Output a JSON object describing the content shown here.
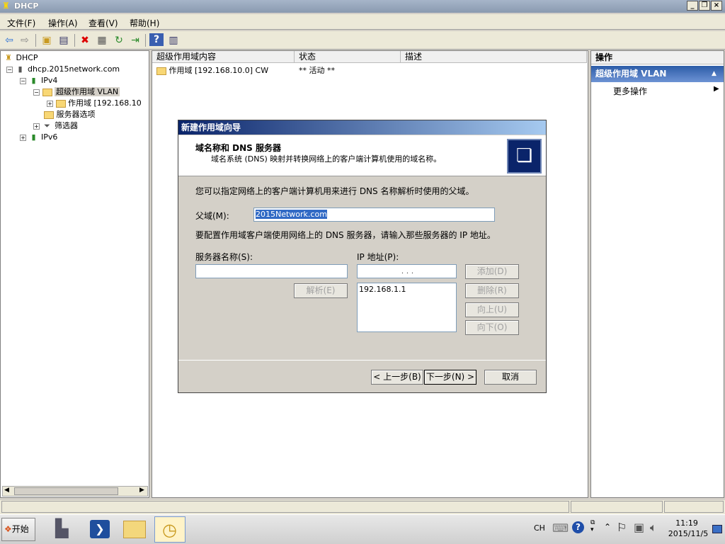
{
  "window": {
    "title": "DHCP"
  },
  "menu": [
    "文件(F)",
    "操作(A)",
    "查看(V)",
    "帮助(H)"
  ],
  "tree": {
    "root": "DHCP",
    "server": "dhcp.2015network.com",
    "ipv4": "IPv4",
    "superscope": "超级作用域 VLAN",
    "scope": "作用域 [192.168.10",
    "server_options": "服务器选项",
    "filters": "筛选器",
    "ipv6": "IPv6"
  },
  "content": {
    "columns": [
      "超级作用域内容",
      "状态",
      "描述"
    ],
    "rows": [
      {
        "name": "作用域 [192.168.10.0] CW",
        "status": "** 活动 **",
        "desc": ""
      }
    ]
  },
  "actions": {
    "header": "操作",
    "section": "超级作用域 VLAN",
    "more": "更多操作"
  },
  "dialog": {
    "title": "新建作用域向导",
    "heading": "域名称和 DNS 服务器",
    "subheading": "域名系统 (DNS) 映射并转换网络上的客户端计算机使用的域名称。",
    "intro": "您可以指定网络上的客户端计算机用来进行 DNS 名称解析时使用的父域。",
    "parent_domain_label": "父域(M):",
    "parent_domain_value": "2015Network.com",
    "dns_intro": "要配置作用域客户端使用网络上的 DNS 服务器，请输入那些服务器的 IP 地址。",
    "server_name_label": "服务器名称(S):",
    "ip_label": "IP 地址(P):",
    "ip_placeholder": ".     .     .",
    "resolve_button": "解析(E)",
    "add_button": "添加(D)",
    "remove_button": "删除(R)",
    "up_button": "向上(U)",
    "down_button": "向下(O)",
    "ip_list": [
      "192.168.1.1"
    ],
    "back_button": "< 上一步(B)",
    "next_button": "下一步(N) >",
    "cancel_button": "取消"
  },
  "taskbar": {
    "start": "开始",
    "lang": "CH",
    "time": "11:19",
    "date": "2015/11/5"
  }
}
